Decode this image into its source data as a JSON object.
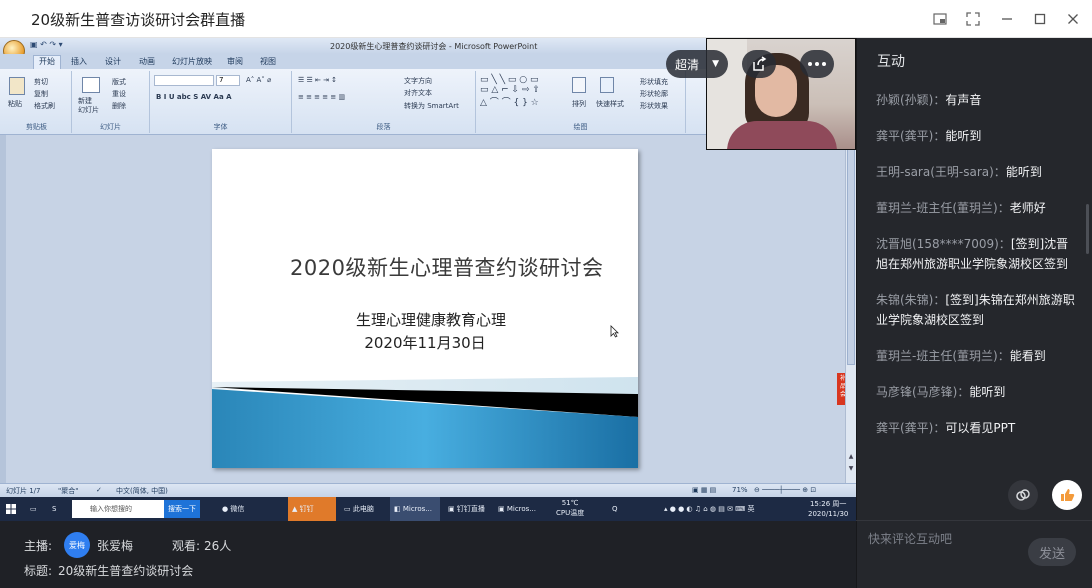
{
  "window": {
    "title": "20级新生普查访谈研讨会群直播"
  },
  "ppt": {
    "window_title": "2020级新生心理普查约谈研讨会 - Microsoft PowerPoint",
    "tabs": [
      "开始",
      "插入",
      "设计",
      "动画",
      "幻灯片放映",
      "审阅",
      "视图"
    ],
    "groups": [
      "剪贴板",
      "幻灯片",
      "字体",
      "段落",
      "绘图"
    ],
    "clipboard": {
      "paste": "粘贴",
      "cut": "剪切",
      "copy": "复制",
      "format_painter": "格式刷"
    },
    "slides_group": {
      "new_slide": "新建\n幻灯片",
      "layout": "版式",
      "reset": "重设",
      "delete": "删除"
    },
    "font_size": "7",
    "paragraph": {
      "text_direction": "文字方向",
      "align_text": "对齐文本",
      "smartart": "转换为 SmartArt"
    },
    "drawing": {
      "arrange": "排列",
      "quick_styles": "快速样式",
      "fill": "形状填充",
      "outline": "形状轮廓",
      "effects": "形状效果"
    },
    "slide": {
      "title": "2020级新生心理普查约谈研讨会",
      "subtitle1": "生理心理健康教育心理",
      "subtitle2": "2020年11月30日"
    },
    "side_tag": "补\n品\n会",
    "status": {
      "slide_num": "幻灯片 1/7",
      "theme": "\"聚合\"",
      "language": "中文(简体, 中国)",
      "zoom": "71%"
    }
  },
  "taskbar": {
    "search_placeholder": "输入你想搜的",
    "search_button": "搜索一下",
    "apps": [
      "微信",
      "钉钉",
      "此电脑",
      "Micros...",
      "钉钉直播",
      "Micros..."
    ],
    "weather_temp": "51℃",
    "weather_label": "CPU温度",
    "time": "15:26 周一",
    "date": "2020/11/30"
  },
  "overlay": {
    "quality": "超清"
  },
  "info": {
    "host_label": "主播:",
    "host_avatar": "爱梅",
    "host_name": "张爱梅",
    "viewers_label": "观看:",
    "viewers": "26人",
    "topic_label": "标题:",
    "topic": "20级新生普查约谈研讨会"
  },
  "panel": {
    "title": "互动",
    "messages": [
      {
        "name": "孙颖(孙颖)：",
        "text": "有声音"
      },
      {
        "name": "龚平(龚平)：",
        "text": "能听到"
      },
      {
        "name": "王明-sara(王明-sara)：",
        "text": "能听到"
      },
      {
        "name": "董玥兰-班主任(董玥兰)：",
        "text": "老师好"
      },
      {
        "name": "沈晋旭(158****7009)：",
        "text": "[签到]沈晋旭在郑州旅游职业学院象湖校区签到"
      },
      {
        "name": "朱锦(朱锦)：",
        "text": "[签到]朱锦在郑州旅游职业学院象湖校区签到"
      },
      {
        "name": "董玥兰-班主任(董玥兰)：",
        "text": "能看到"
      },
      {
        "name": "马彦锋(马彦锋)：",
        "text": "能听到"
      },
      {
        "name": "龚平(龚平)：",
        "text": "可以看见PPT"
      }
    ],
    "comment_placeholder": "快来评论互动吧",
    "send_label": "发送"
  }
}
